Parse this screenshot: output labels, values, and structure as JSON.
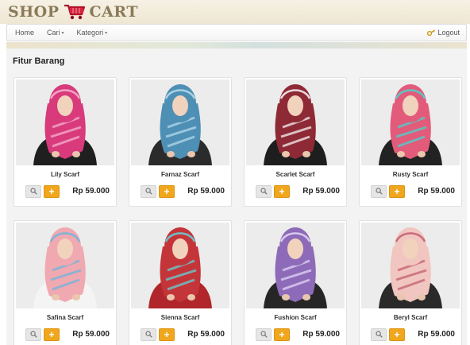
{
  "brand": {
    "word_left": "SHOP",
    "word_right": "CART",
    "logo_icon": "shopping-cart-icon"
  },
  "navbar": {
    "items": [
      {
        "label": "Home"
      },
      {
        "label": "Cari",
        "caret": "▾"
      },
      {
        "label": "Kategori",
        "caret": "▾"
      }
    ],
    "logout_label": "Logout",
    "logout_icon": "key-icon"
  },
  "section": {
    "title": "Fitur Barang"
  },
  "actions": {
    "zoom_icon": "magnifier-icon",
    "add_label": "+"
  },
  "products": [
    {
      "name": "Lily Scarf",
      "price": "Rp 59.000",
      "colors": {
        "scarf": "#d83a7c",
        "accent": "#f2a3c4",
        "body": "#1f1f1f"
      }
    },
    {
      "name": "Farnaz Scarf",
      "price": "Rp 59.000",
      "colors": {
        "scarf": "#4e8fb5",
        "accent": "#a9d1e3",
        "body": "#2b2b2b"
      }
    },
    {
      "name": "Scarlet Scarf",
      "price": "Rp 59.000",
      "colors": {
        "scarf": "#8e2a35",
        "accent": "#e9d9dc",
        "body": "#1e1e1e"
      }
    },
    {
      "name": "Rusty Scarf",
      "price": "Rp 59.000",
      "colors": {
        "scarf": "#e25b7a",
        "accent": "#5bc6c4",
        "body": "#222222"
      }
    },
    {
      "name": "Safina Scarf",
      "price": "Rp 59.000",
      "colors": {
        "scarf": "#f0a9b0",
        "accent": "#7fb3d8",
        "body": "#f4f4f4"
      }
    },
    {
      "name": "Sienna Scarf",
      "price": "Rp 59.000",
      "colors": {
        "scarf": "#c4353a",
        "accent": "#6fbfc4",
        "body": "#b0262b"
      }
    },
    {
      "name": "Fushion Scarf",
      "price": "Rp 59.000",
      "colors": {
        "scarf": "#8d6bb8",
        "accent": "#d8c8ee",
        "body": "#262626"
      }
    },
    {
      "name": "Beryl Scarf",
      "price": "Rp 59.000",
      "colors": {
        "scarf": "#f1c6c0",
        "accent": "#c96b7a",
        "body": "#2a2a2a"
      }
    }
  ]
}
